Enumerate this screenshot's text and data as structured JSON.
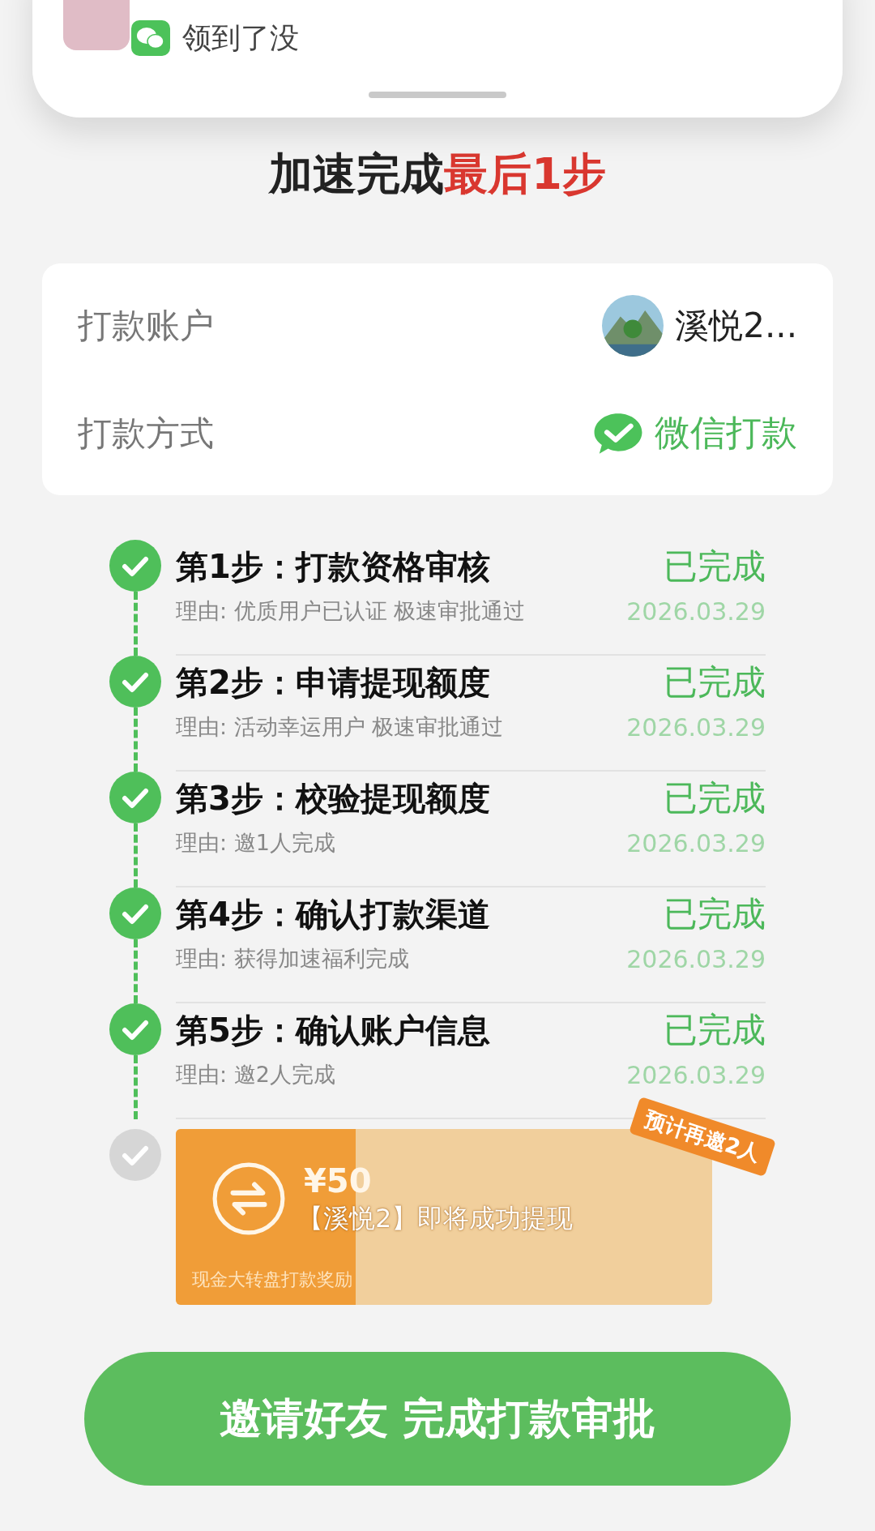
{
  "notification": {
    "message": "领到了没"
  },
  "header": {
    "title_parts": [
      {
        "text": "加速完成",
        "highlight": false
      },
      {
        "text": "最后1步",
        "highlight": true
      }
    ]
  },
  "account_card": {
    "rows": [
      {
        "kind": "account",
        "label": "打款账户",
        "value": "溪悦2..."
      },
      {
        "kind": "method",
        "label": "打款方式",
        "value": "微信打款"
      }
    ]
  },
  "steps": [
    {
      "title": "第1步：打款资格审核",
      "reason": "理由: 优质用户已认证 极速审批通过",
      "status": "已完成",
      "date": "2026.03.29",
      "done": true
    },
    {
      "title": "第2步：申请提现额度",
      "reason": "理由: 活动幸运用户 极速审批通过",
      "status": "已完成",
      "date": "2026.03.29",
      "done": true
    },
    {
      "title": "第3步：校验提现额度",
      "reason": "理由: 邀1人完成",
      "status": "已完成",
      "date": "2026.03.29",
      "done": true
    },
    {
      "title": "第4步：确认打款渠道",
      "reason": "理由: 获得加速福利完成",
      "status": "已完成",
      "date": "2026.03.29",
      "done": true
    },
    {
      "title": "第5步：确认账户信息",
      "reason": "理由: 邀2人完成",
      "status": "已完成",
      "date": "2026.03.29",
      "done": true
    }
  ],
  "reward": {
    "done": false,
    "amount": "¥50",
    "message": "【溪悦2】即将成功提现",
    "footnote": "现金大转盘打款奖励",
    "badge": "预计再邀2人",
    "level": 0.335
  },
  "button": {
    "label": "邀请好友 完成打款审批"
  }
}
